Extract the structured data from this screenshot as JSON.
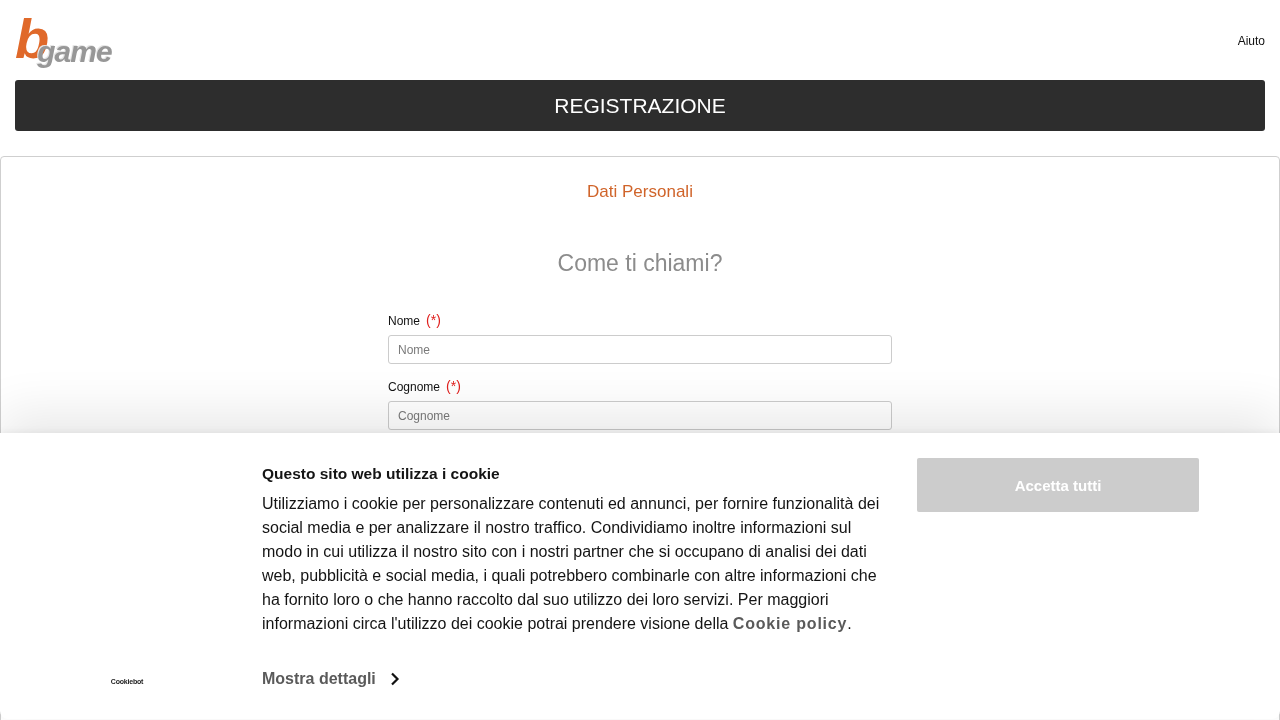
{
  "header": {
    "logo": {
      "mark": "b",
      "word": "game"
    },
    "help_link": "Aiuto"
  },
  "title_bar": {
    "title": "REGISTRAZIONE"
  },
  "form": {
    "section": "Dati Personali",
    "question": "Come ti chiami?",
    "fields": [
      {
        "label": "Nome",
        "required_mark": "(*)",
        "placeholder": "Nome"
      },
      {
        "label": "Cognome",
        "required_mark": "(*)",
        "placeholder": "Cognome"
      }
    ]
  },
  "cookie_banner": {
    "brand": "Cookiebot",
    "title": "Questo sito web utilizza i cookie",
    "text": "Utilizziamo i cookie per personalizzare contenuti ed annunci, per fornire funzionalità dei social media e per analizzare il nostro traffico. Condividiamo inoltre informazioni sul modo in cui utilizza il nostro sito con i nostri partner che si occupano di analisi dei dati web, pubblicità e social media, i quali potrebbero combinarle con altre informazioni che ha fornito loro o che hanno raccolto dal suo utilizzo dei loro servizi. Per maggiori informazioni circa l'utilizzo dei cookie potrai prendere visione della ",
    "policy_link": "Cookie policy",
    "text_end": ".",
    "details_link": "Mostra dettagli",
    "accept_button": "Accetta tutti"
  }
}
